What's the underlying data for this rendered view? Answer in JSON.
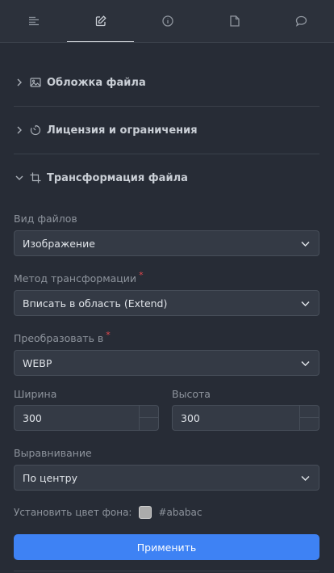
{
  "tabs": [
    {
      "icon": "list-icon"
    },
    {
      "icon": "edit-icon",
      "active": true
    },
    {
      "icon": "info-icon"
    },
    {
      "icon": "file-icon"
    },
    {
      "icon": "comment-icon"
    }
  ],
  "sections": {
    "cover": {
      "title": "Обложка файла",
      "icon": "image-icon",
      "expanded": false
    },
    "license": {
      "title": "Лицензия и ограничения",
      "icon": "timer-icon",
      "expanded": false
    },
    "transform": {
      "title": "Трансформация файла",
      "icon": "crop-icon",
      "expanded": true
    }
  },
  "form": {
    "file_type": {
      "label": "Вид файлов",
      "value": "Изображение"
    },
    "method": {
      "label": "Метод трансформации",
      "required": "*",
      "value": "Вписать в область (Extend)"
    },
    "convert": {
      "label": "Преобразовать в",
      "required": "*",
      "value": "WEBP"
    },
    "width": {
      "label": "Ширина",
      "value": "300"
    },
    "height": {
      "label": "Высота",
      "value": "300"
    },
    "align": {
      "label": "Выравнивание",
      "value": "По центру"
    },
    "bg": {
      "label": "Установить цвет фона:",
      "color": "#ababab",
      "hex": "#ababac"
    },
    "apply_label": "Применить"
  },
  "colors": {
    "accent": "#3e82f4",
    "background": "#272c36",
    "required": "#e5484d"
  }
}
